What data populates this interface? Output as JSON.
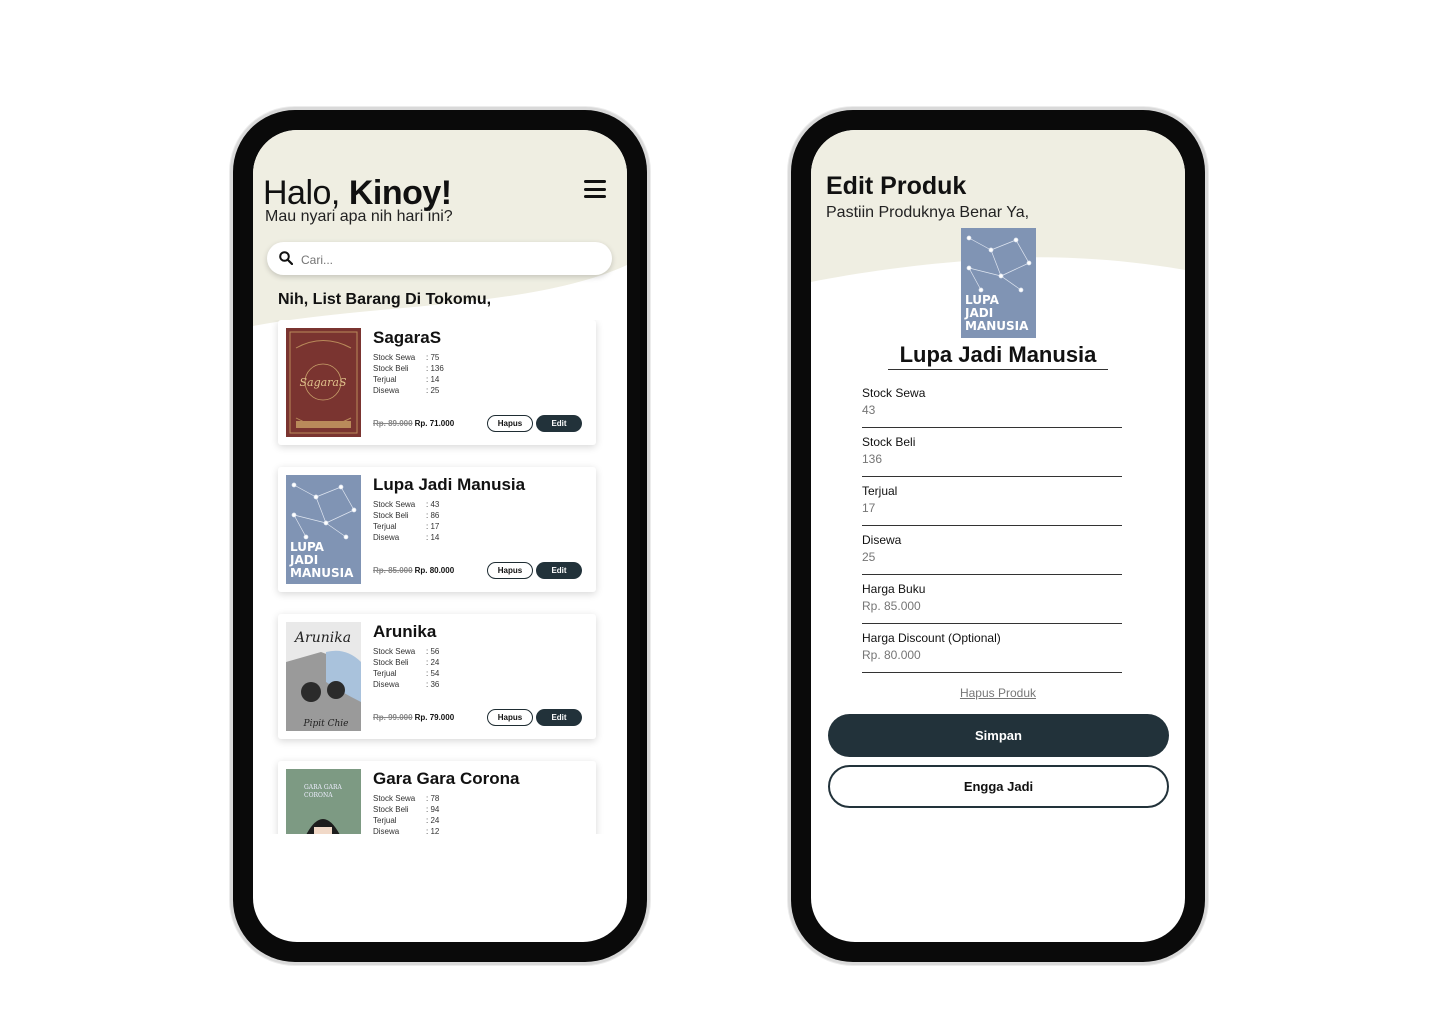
{
  "home": {
    "greeting_prefix": "Halo, ",
    "user_name": "Kinoy!",
    "subtitle": "Mau nyari apa nih hari ini?",
    "search_placeholder": "Cari...",
    "list_title": "Nih, List Barang Di Tokomu,",
    "stat_labels": {
      "stock_sewa": "Stock Sewa",
      "stock_beli": "Stock Beli",
      "terjual": "Terjual",
      "disewa": "Disewa"
    },
    "hapus_label": "Hapus",
    "edit_label": "Edit",
    "products": [
      {
        "name": "SagaraS",
        "stock_sewa": ": 75",
        "stock_beli": ": 136",
        "terjual": ": 14",
        "disewa": ": 25",
        "old_price": "Rp. 89.000",
        "price": "Rp. 71.000",
        "cover_text": "SAGARAS"
      },
      {
        "name": "Lupa Jadi Manusia",
        "stock_sewa": ": 43",
        "stock_beli": ": 86",
        "terjual": ": 17",
        "disewa": ": 14",
        "old_price": "Rp. 85.000",
        "price": "Rp. 80.000",
        "cover_text": "LUPA JADI MANUSIA"
      },
      {
        "name": "Arunika",
        "stock_sewa": ": 56",
        "stock_beli": ": 24",
        "terjual": ": 54",
        "disewa": ": 36",
        "old_price": "Rp. 99.000",
        "price": "Rp. 79.000",
        "cover_text": "Arunika"
      },
      {
        "name": "Gara Gara Corona",
        "stock_sewa": ": 78",
        "stock_beli": ": 94",
        "terjual": ": 24",
        "disewa": ": 12",
        "old_price": "",
        "price": "",
        "cover_text": "GARA GARA CORONA"
      }
    ]
  },
  "edit": {
    "title": "Edit Produk",
    "subtitle": "Pastiin Produknya Benar Ya,",
    "product_name": "Lupa Jadi Manusia",
    "cover_text": [
      "LUPA",
      "JADI",
      "MANUSIA"
    ],
    "fields": [
      {
        "label": "Stock Sewa",
        "placeholder": "43"
      },
      {
        "label": "Stock Beli",
        "placeholder": "136"
      },
      {
        "label": "Terjual",
        "placeholder": "17"
      },
      {
        "label": "Disewa",
        "placeholder": "25"
      },
      {
        "label": "Harga Buku",
        "placeholder": "Rp. 85.000"
      },
      {
        "label": "Harga Discount (Optional)",
        "placeholder": "Rp. 80.000"
      }
    ],
    "delete_link": "Hapus Produk",
    "save_label": "Simpan",
    "cancel_label": "Engga Jadi"
  },
  "colors": {
    "header_bg": "#efeee2",
    "dark_button": "#22323a",
    "cover_blue": "#8094b4",
    "cover_red": "#7a3430",
    "cover_green": "#7d9a83"
  },
  "icons": [
    "menu-icon",
    "search-icon"
  ]
}
